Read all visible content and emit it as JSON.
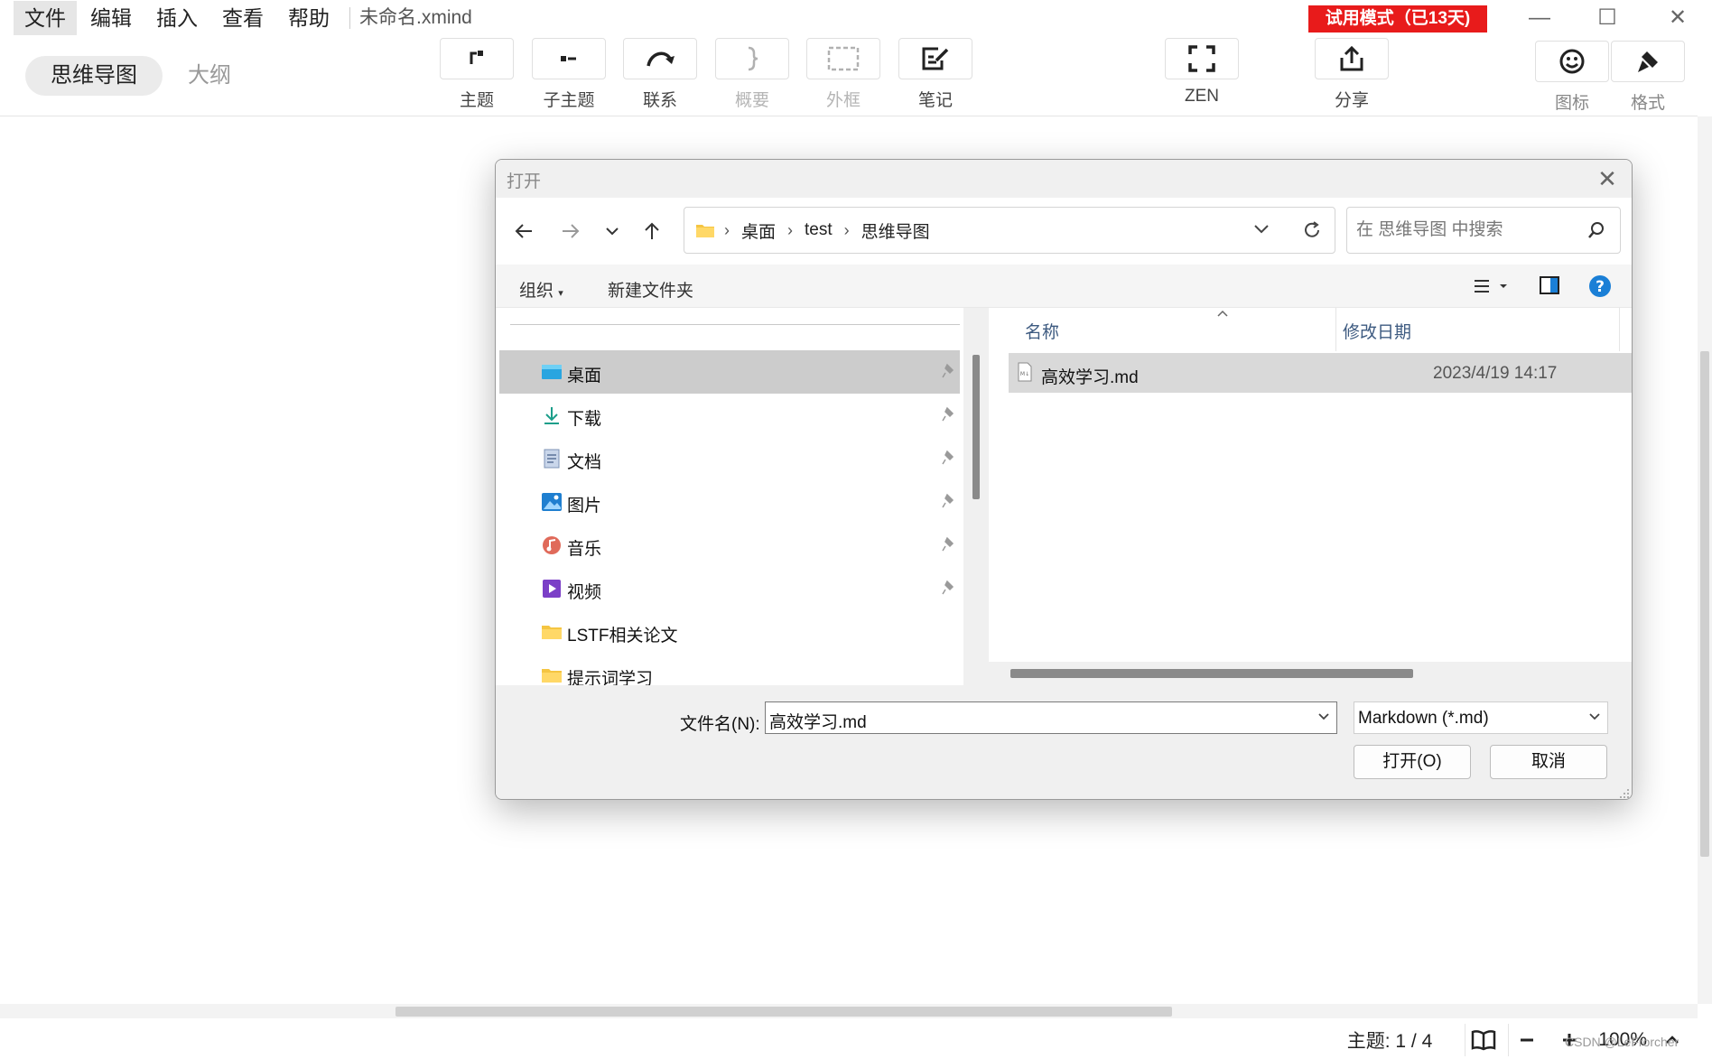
{
  "menubar": {
    "items": [
      "文件",
      "编辑",
      "插入",
      "查看",
      "帮助"
    ],
    "doc_title": "未命名.xmind",
    "trial_badge": "试用模式（已13天)"
  },
  "view_switch": {
    "mindmap": "思维导图",
    "outline": "大纲"
  },
  "toolbar": {
    "topic": "主题",
    "subtopic": "子主题",
    "relationship": "联系",
    "summary": "概要",
    "boundary": "外框",
    "note": "笔记",
    "zen": "ZEN",
    "share": "分享",
    "icon": "图标",
    "format": "格式"
  },
  "dialog": {
    "title": "打开",
    "breadcrumb": [
      "桌面",
      "test",
      "思维导图"
    ],
    "search_placeholder": "在 思维导图 中搜索",
    "commands": {
      "organize": "组织",
      "new_folder": "新建文件夹"
    },
    "nav_items": [
      {
        "label": "桌面",
        "icon": "desktop-icon",
        "pinned": true,
        "selected": true
      },
      {
        "label": "下载",
        "icon": "download-icon",
        "pinned": true
      },
      {
        "label": "文档",
        "icon": "document-icon",
        "pinned": true
      },
      {
        "label": "图片",
        "icon": "picture-icon",
        "pinned": true
      },
      {
        "label": "音乐",
        "icon": "music-icon",
        "pinned": true
      },
      {
        "label": "视频",
        "icon": "video-icon",
        "pinned": true
      },
      {
        "label": "LSTF相关论文",
        "icon": "folder-icon",
        "pinned": false
      },
      {
        "label": "提示词学习",
        "icon": "folder-icon",
        "pinned": false
      }
    ],
    "columns": {
      "name": "名称",
      "modified": "修改日期"
    },
    "files": [
      {
        "name": "高效学习.md",
        "modified": "2023/4/19 14:17"
      }
    ],
    "filename_label": "文件名(N):",
    "filename_value": "高效学习.md",
    "filetype": "Markdown (*.md)",
    "open_button": "打开(O)",
    "cancel_button": "取消"
  },
  "statusbar": {
    "topic_count": "主题: 1 / 4",
    "zoom": "100%"
  },
  "watermark": "CSDN @LeFrorcher",
  "colors": {
    "trial_red": "#e81b1b",
    "selection_gray": "#d9d9d9",
    "column_header_blue": "#3d5a80",
    "help_blue": "#1a7fd6"
  }
}
